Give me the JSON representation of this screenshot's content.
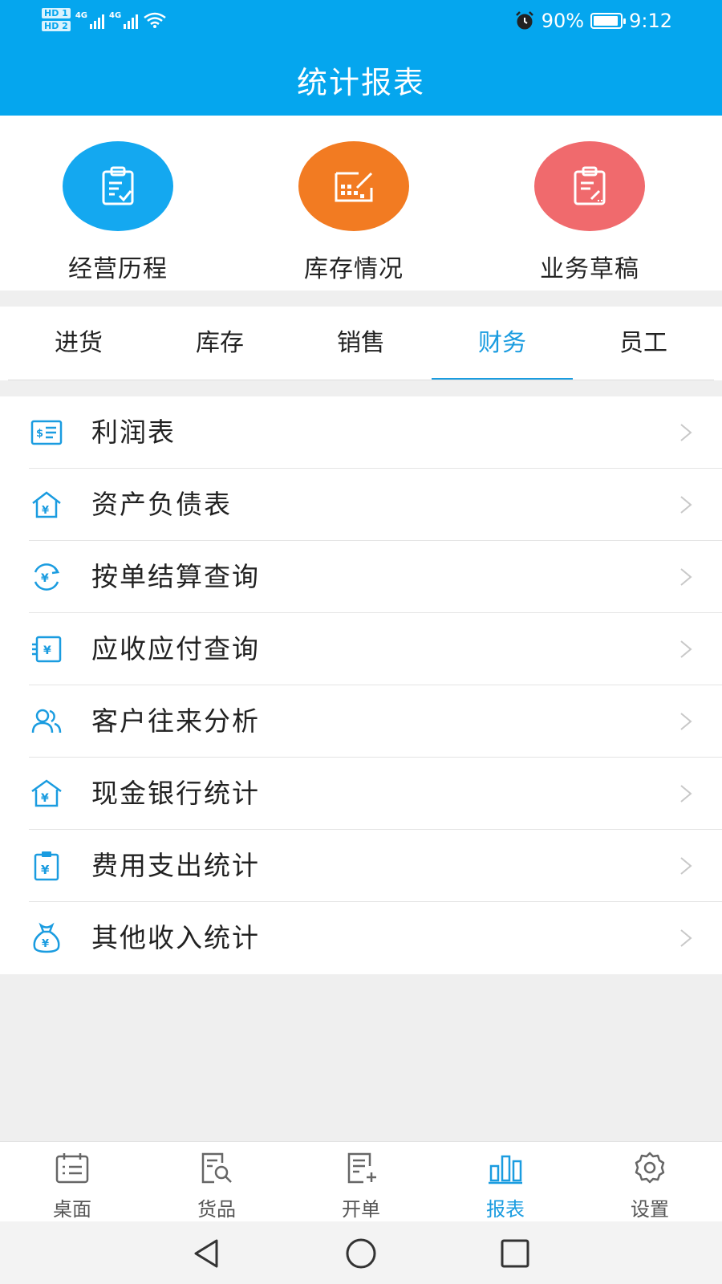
{
  "status_bar": {
    "hd1": "HD 1",
    "hd2": "HD 2",
    "net1": "4G",
    "net2": "4G",
    "battery": "90%",
    "time": "9:12"
  },
  "header": {
    "title": "统计报表"
  },
  "quick_actions": [
    {
      "label": "经营历程",
      "color": "#14a8f0",
      "icon": "clipboard-check-icon"
    },
    {
      "label": "库存情况",
      "color": "#f27b22",
      "icon": "inventory-chart-icon"
    },
    {
      "label": "业务草稿",
      "color": "#f06a6d",
      "icon": "clipboard-edit-icon"
    }
  ],
  "tabs": [
    {
      "label": "进货",
      "active": false
    },
    {
      "label": "库存",
      "active": false
    },
    {
      "label": "销售",
      "active": false
    },
    {
      "label": "财务",
      "active": true
    },
    {
      "label": "员工",
      "active": false
    }
  ],
  "finance_items": [
    {
      "label": "利润表",
      "icon": "profit-statement-icon"
    },
    {
      "label": "资产负债表",
      "icon": "balance-sheet-icon"
    },
    {
      "label": "按单结算查询",
      "icon": "settlement-query-icon"
    },
    {
      "label": "应收应付查询",
      "icon": "receivable-payable-icon"
    },
    {
      "label": "客户往来分析",
      "icon": "customers-icon"
    },
    {
      "label": "现金银行统计",
      "icon": "bank-icon"
    },
    {
      "label": "费用支出统计",
      "icon": "expense-icon"
    },
    {
      "label": "其他收入统计",
      "icon": "money-bag-icon"
    }
  ],
  "bottom_nav": [
    {
      "label": "桌面",
      "icon": "desktop-icon",
      "active": false
    },
    {
      "label": "货品",
      "icon": "goods-search-icon",
      "active": false
    },
    {
      "label": "开单",
      "icon": "new-order-icon",
      "active": false
    },
    {
      "label": "报表",
      "icon": "report-chart-icon",
      "active": true
    },
    {
      "label": "设置",
      "icon": "settings-gear-icon",
      "active": false
    }
  ],
  "colors": {
    "primary": "#05a6ee",
    "accent": "#1a9ce0",
    "icon_blue": "#1a9ce0"
  }
}
